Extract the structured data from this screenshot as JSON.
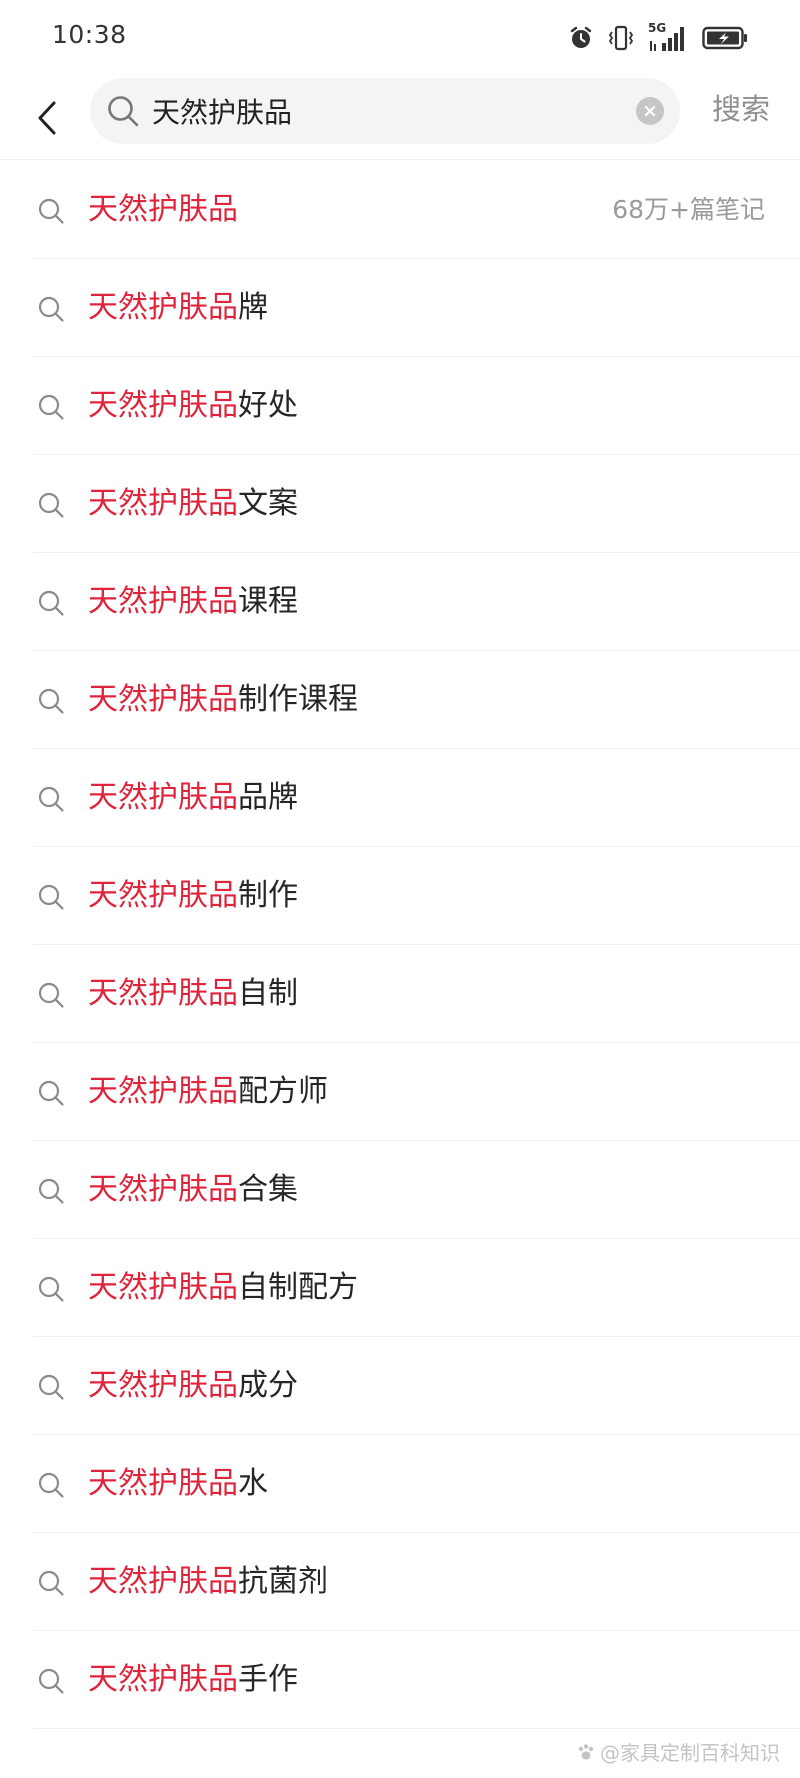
{
  "status_bar": {
    "time": "10:38",
    "network": "5G",
    "icons": [
      "alarm-icon",
      "vibrate-icon",
      "signal-icon",
      "battery-icon"
    ]
  },
  "header": {
    "back_icon": "chevron-left-icon",
    "search_value": "天然护肤品",
    "search_label": "搜索",
    "clear_icon": "clear-icon"
  },
  "suggestions": [
    {
      "keyword": "天然护肤品",
      "suffix": "",
      "note_count": "68万+篇笔记"
    },
    {
      "keyword": "天然护肤品",
      "suffix": "牌"
    },
    {
      "keyword": "天然护肤品",
      "suffix": "好处"
    },
    {
      "keyword": "天然护肤品",
      "suffix": "文案"
    },
    {
      "keyword": "天然护肤品",
      "suffix": "课程"
    },
    {
      "keyword": "天然护肤品",
      "suffix": "制作课程"
    },
    {
      "keyword": "天然护肤品",
      "suffix": "品牌"
    },
    {
      "keyword": "天然护肤品",
      "suffix": "制作"
    },
    {
      "keyword": "天然护肤品",
      "suffix": "自制"
    },
    {
      "keyword": "天然护肤品",
      "suffix": "配方师"
    },
    {
      "keyword": "天然护肤品",
      "suffix": "合集"
    },
    {
      "keyword": "天然护肤品",
      "suffix": "自制配方"
    },
    {
      "keyword": "天然护肤品",
      "suffix": "成分"
    },
    {
      "keyword": "天然护肤品",
      "suffix": "水"
    },
    {
      "keyword": "天然护肤品",
      "suffix": "抗菌剂"
    },
    {
      "keyword": "天然护肤品",
      "suffix": "手作"
    }
  ],
  "watermark": "@家具定制百科知识",
  "colors": {
    "highlight": "#e0243c",
    "text": "#262626",
    "muted": "#9a9a9a",
    "search_bg": "#f4f4f6"
  }
}
